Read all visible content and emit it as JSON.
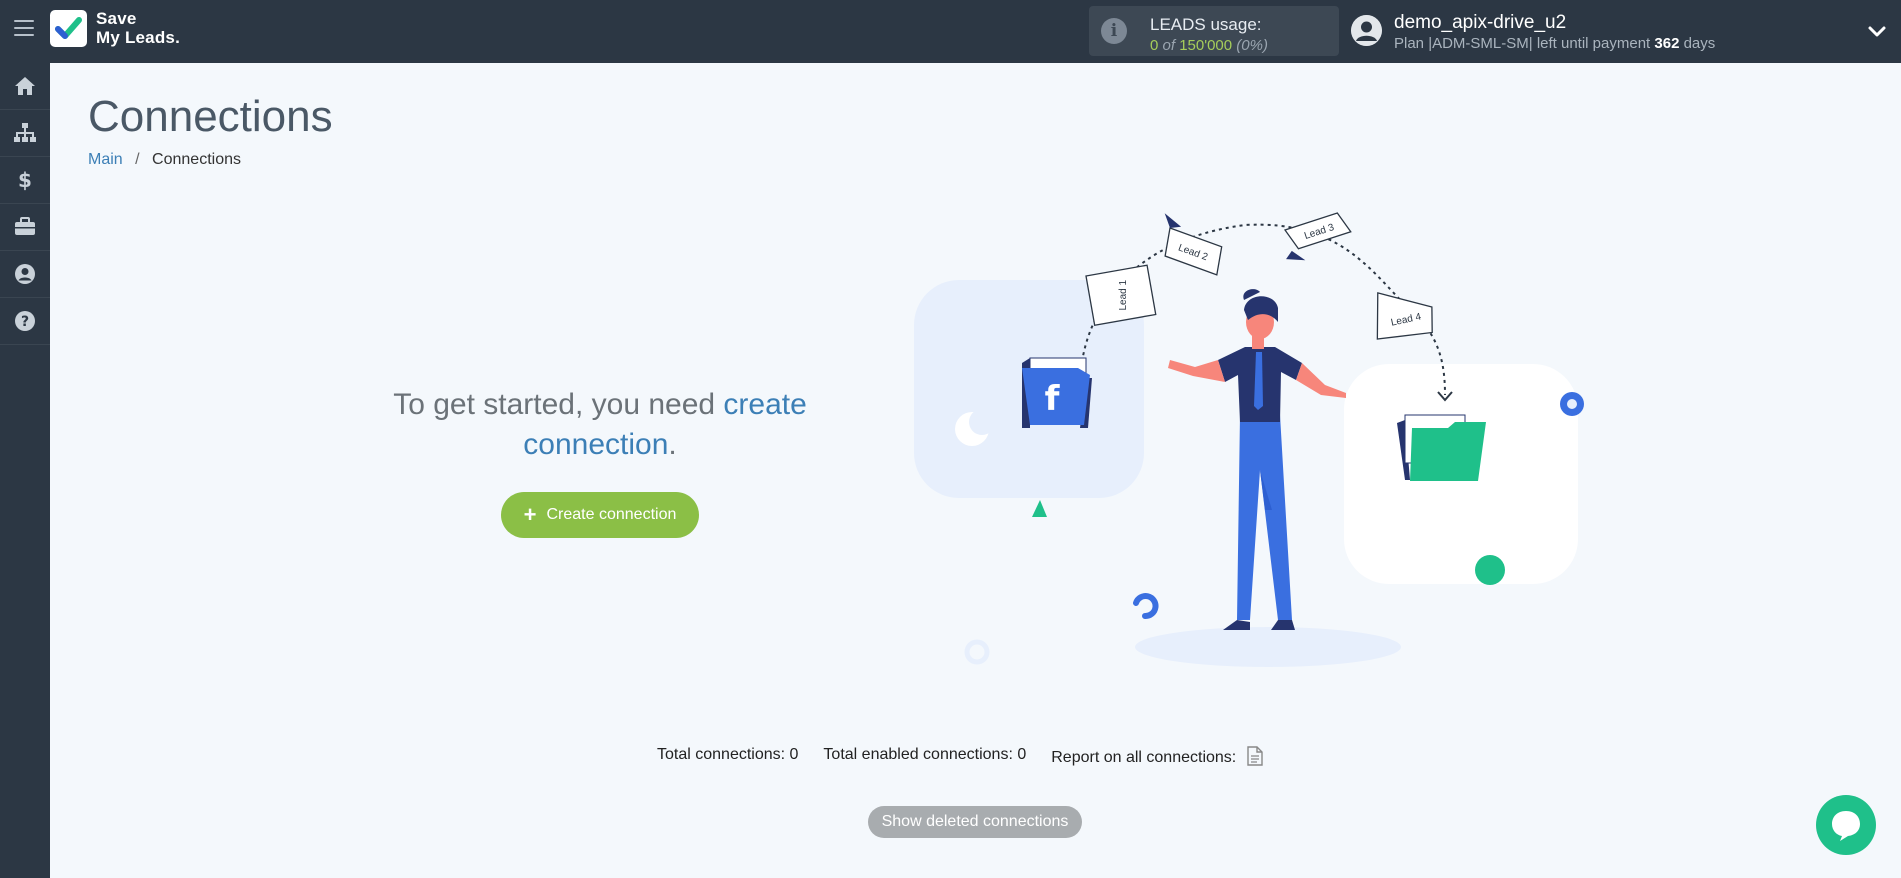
{
  "app": {
    "logo_line1": "Save",
    "logo_line2": "My Leads.",
    "accent": "#8bbf46",
    "topbar_bg": "#2c3744"
  },
  "usage": {
    "label": "LEADS usage:",
    "used": "0",
    "of": "of",
    "limit": "150'000",
    "percent": "(0%)"
  },
  "user": {
    "name": "demo_apix-drive_u2",
    "plan_prefix": "Plan |ADM-SML-SM| left until payment",
    "days": "362",
    "days_suffix": "days"
  },
  "sidebar": {
    "items": [
      {
        "icon": "home-icon"
      },
      {
        "icon": "sitemap-icon"
      },
      {
        "icon": "dollar-icon"
      },
      {
        "icon": "briefcase-icon"
      },
      {
        "icon": "user-circle-icon"
      },
      {
        "icon": "question-circle-icon"
      }
    ]
  },
  "page": {
    "title": "Connections",
    "breadcrumb_main": "Main",
    "breadcrumb_sep": "/",
    "breadcrumb_current": "Connections"
  },
  "empty_state": {
    "text_before": "To get started, you need",
    "link_text": "create connection",
    "text_after": ".",
    "button_icon": "+",
    "button_label": "Create connection"
  },
  "illustration": {
    "lead_labels": [
      "Lead 1",
      "Lead 2",
      "Lead 3",
      "Lead 4"
    ],
    "source_letter": "f"
  },
  "stats": {
    "total": "Total connections: 0",
    "enabled": "Total enabled connections: 0",
    "report": "Report on all connections:"
  },
  "footer": {
    "show_deleted": "Show deleted connections"
  }
}
